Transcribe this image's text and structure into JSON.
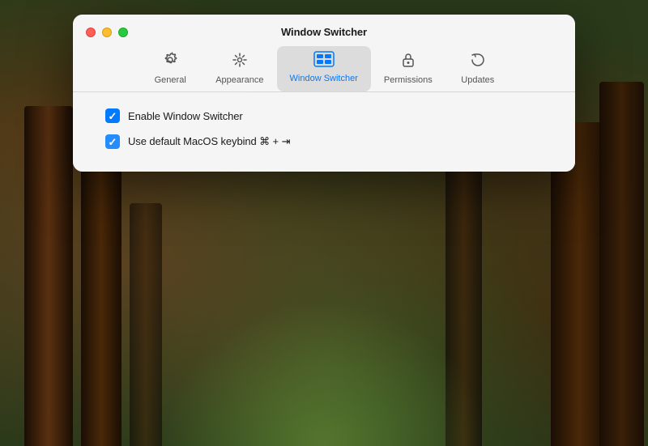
{
  "window": {
    "title": "Window Switcher"
  },
  "controls": {
    "close": "close",
    "minimize": "minimize",
    "maximize": "maximize"
  },
  "tabs": [
    {
      "id": "general",
      "label": "General",
      "active": false
    },
    {
      "id": "appearance",
      "label": "Appearance",
      "active": false
    },
    {
      "id": "window-switcher",
      "label": "Window Switcher",
      "active": true
    },
    {
      "id": "permissions",
      "label": "Permissions",
      "active": false
    },
    {
      "id": "updates",
      "label": "Updates",
      "active": false
    }
  ],
  "options": [
    {
      "id": "enable-window-switcher",
      "label": "Enable Window Switcher",
      "checked": true,
      "loading": false
    },
    {
      "id": "use-default-macos-keybind",
      "label": "Use default MacOS keybind ⌘ + ⇥",
      "checked": true,
      "loading": true
    }
  ]
}
